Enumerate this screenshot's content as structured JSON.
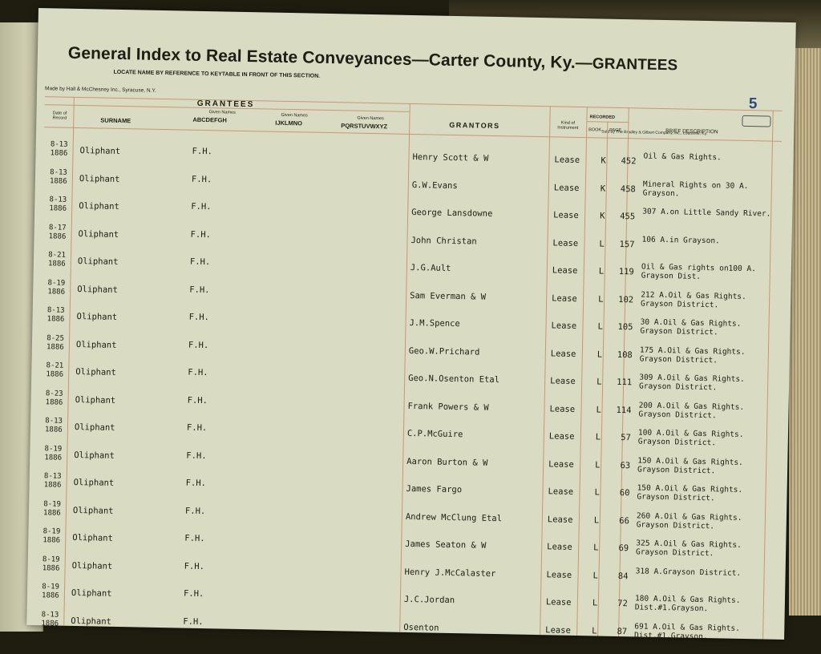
{
  "header": {
    "title": "General Index to Real Estate Conveyances—Carter County, Ky.—",
    "title_suffix": "GRANTEES",
    "page_number": "5",
    "locate_note": "LOCATE NAME BY REFERENCE TO KEYTABLE IN FRONT OF THIS SECTION.",
    "maker": "Made by Hall & McChesney Inc., Syracuse, N.Y.",
    "seller": "Sold by The Bradley & Gilbert Company, Inc., Louisville, Ky."
  },
  "columns": {
    "date": "Date of Record",
    "grantees": "GRANTEES",
    "surname": "SURNAME",
    "given_1_label": "Given Names",
    "given_1": "ABCDEFGH",
    "given_2_label": "Given Names",
    "given_2": "IJKLMNO",
    "given_3_label": "Given Names",
    "given_3": "PQRSTUVWXYZ",
    "grantors": "GRANTORS",
    "kind": "Kind of Instrument",
    "recorded": "RECORDED",
    "book": "BOOK",
    "page": "PAGE",
    "description": "BRIEF DESCRIPTION"
  },
  "rows": [
    {
      "date": "8-13\n1886",
      "surname": "Oliphant",
      "given": "F.H.",
      "grantor": "Henry Scott & W",
      "kind": "Lease",
      "book": "K",
      "page": "452",
      "desc": "Oil & Gas Rights."
    },
    {
      "date": "8-13\n1886",
      "surname": "Oliphant",
      "given": "F.H.",
      "grantor": "G.W.Evans",
      "kind": "Lease",
      "book": "K",
      "page": "458",
      "desc": "Mineral Rights on 30 A.\nGrayson."
    },
    {
      "date": "8-13\n1886",
      "surname": "Oliphant",
      "given": "F.H.",
      "grantor": "George Lansdowne",
      "kind": "Lease",
      "book": "K",
      "page": "455",
      "desc": "307 A.on Little Sandy River."
    },
    {
      "date": "8-17\n1886",
      "surname": "Oliphant",
      "given": "F.H.",
      "grantor": "John Christan",
      "kind": "Lease",
      "book": "L",
      "page": "157",
      "desc": "106 A.in Grayson."
    },
    {
      "date": "8-21\n1886",
      "surname": "Oliphant",
      "given": "F.H.",
      "grantor": "J.G.Ault",
      "kind": "Lease",
      "book": "L",
      "page": "119",
      "desc": "Oil & Gas rights on100 A.\nGrayson Dist."
    },
    {
      "date": "8-19\n1886",
      "surname": "Oliphant",
      "given": "F.H.",
      "grantor": "Sam Everman & W",
      "kind": "Lease",
      "book": "L",
      "page": "102",
      "desc": "212 A.Oil & Gas Rights.\nGrayson District."
    },
    {
      "date": "8-13\n1886",
      "surname": "Oliphant",
      "given": "F.H.",
      "grantor": "J.M.Spence",
      "kind": "Lease",
      "book": "L",
      "page": "105",
      "desc": "30 A.Oil & Gas Rights.\nGrayson District."
    },
    {
      "date": "8-25\n1886",
      "surname": "Oliphant",
      "given": "F.H.",
      "grantor": "Geo.W.Prichard",
      "kind": "Lease",
      "book": "L",
      "page": "108",
      "desc": "175 A.Oil & Gas Rights.\nGrayson District."
    },
    {
      "date": "8-21\n1886",
      "surname": "Oliphant",
      "given": "F.H.",
      "grantor": "Geo.N.Osenton Etal",
      "kind": "Lease",
      "book": "L",
      "page": "111",
      "desc": "309 A.Oil & Gas Rights.\nGrayson District."
    },
    {
      "date": "8-23\n1886",
      "surname": "Oliphant",
      "given": "F.H.",
      "grantor": "Frank Powers & W",
      "kind": "Lease",
      "book": "L",
      "page": "114",
      "desc": "200 A.Oil & Gas Rights.\nGrayson District."
    },
    {
      "date": "8-13\n1886",
      "surname": "Oliphant",
      "given": "F.H.",
      "grantor": "C.P.McGuire",
      "kind": "Lease",
      "book": "L",
      "page": "57",
      "desc": "100 A.Oil & Gas Rights.\nGrayson District."
    },
    {
      "date": "8-19\n1886",
      "surname": "Oliphant",
      "given": "F.H.",
      "grantor": "Aaron Burton & W",
      "kind": "Lease",
      "book": "L",
      "page": "63",
      "desc": "150 A.Oil & Gas Rights.\nGrayson District."
    },
    {
      "date": "8-13\n1886",
      "surname": "Oliphant",
      "given": "F.H.",
      "grantor": "James Fargo",
      "kind": "Lease",
      "book": "L",
      "page": "60",
      "desc": "150 A.Oil & Gas Rights.\nGrayson District."
    },
    {
      "date": "8-19\n1886",
      "surname": "Oliphant",
      "given": "F.H.",
      "grantor": "Andrew McClung Etal",
      "kind": "Lease",
      "book": "L",
      "page": "66",
      "desc": "260 A.Oil & Gas Rights.\nGrayson District."
    },
    {
      "date": "8-19\n1886",
      "surname": "Oliphant",
      "given": "F.H.",
      "grantor": "James Seaton & W",
      "kind": "Lease",
      "book": "L",
      "page": "69",
      "desc": "325 A.Oil & Gas Rights.\nGrayson District."
    },
    {
      "date": "8-19\n1886",
      "surname": "Oliphant",
      "given": "F.H.",
      "grantor": "Henry J.McCalaster",
      "kind": "Lease",
      "book": "L",
      "page": "84",
      "desc": "318 A.Grayson District."
    },
    {
      "date": "8-19\n1886",
      "surname": "Oliphant",
      "given": "F.H.",
      "grantor": "J.C.Jordan",
      "kind": "Lease",
      "book": "L",
      "page": "72",
      "desc": "180 A.Oil & Gas Rights.\nDist.#1.Grayson."
    },
    {
      "date": "8-13\n1886",
      "surname": "Oliphant",
      "given": "F.H.",
      "grantor": "Osenton",
      "kind": "Lease",
      "book": "L",
      "page": "87",
      "desc": "691 A.Oil & Gas Rights.\nDist.#1.Grayson."
    }
  ]
}
